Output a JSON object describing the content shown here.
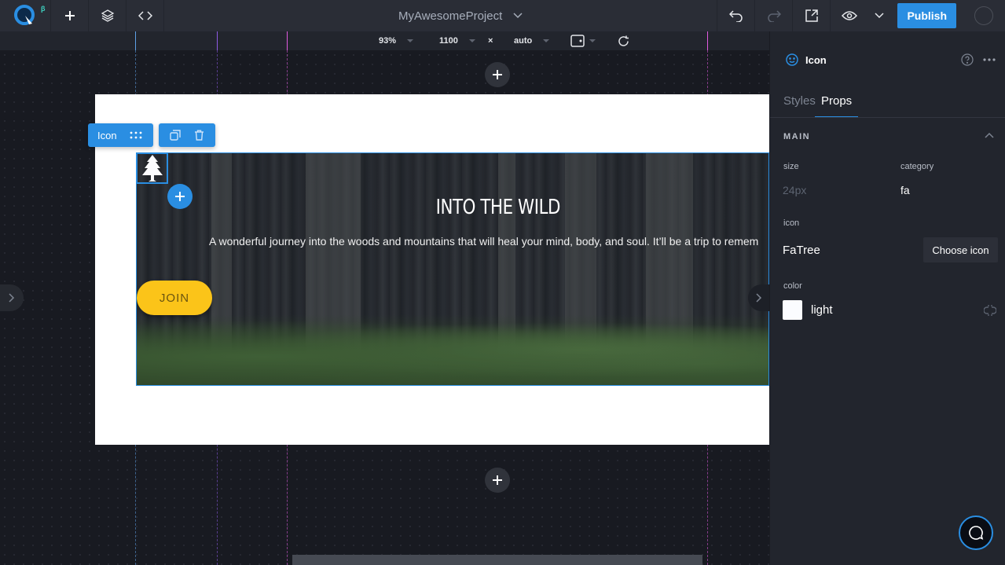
{
  "topbar": {
    "logo_badge": "β",
    "project_name": "MyAwesomeProject",
    "publish_label": "Publish",
    "icons": [
      "logo-icon",
      "add-icon",
      "layers-icon",
      "code-icon",
      "chevron-down-icon",
      "undo-icon",
      "redo-icon",
      "external-link-icon",
      "eye-icon",
      "chevron-down-icon",
      "avatar"
    ]
  },
  "subbar": {
    "zoom": "93%",
    "width": "1100",
    "times": "×",
    "height": "auto",
    "icons": [
      "device-frame-icon",
      "refresh-icon"
    ]
  },
  "canvas": {
    "selection": {
      "label": "Icon",
      "icons": [
        "drag-handle-icon",
        "duplicate-icon",
        "trash-icon"
      ]
    },
    "hero": {
      "title": "INTO THE WILD",
      "subtitle": "A wonderful journey into the woods and mountains that will heal your mind, body, and soul. It’ll be a trip to remem",
      "button_label": "JOIN",
      "icon": "tree-icon"
    },
    "colors": {
      "accent": "#2a8ee2",
      "join": "#fbc419",
      "bp1": "#5ea0e6",
      "bp2": "#8e5be6",
      "bp3": "#e05be0"
    }
  },
  "panel": {
    "component_name": "Icon",
    "tabs": [
      {
        "label": "Styles",
        "active": false
      },
      {
        "label": "Props",
        "active": true
      }
    ],
    "section": "MAIN",
    "props": {
      "size_label": "size",
      "size_placeholder": "24px",
      "category_label": "category",
      "category_value": "fa",
      "icon_label": "icon",
      "icon_value": "FaTree",
      "choose_label": "Choose icon",
      "color_label": "color",
      "color_value": "light",
      "color_swatch": "#fbfcff"
    }
  }
}
